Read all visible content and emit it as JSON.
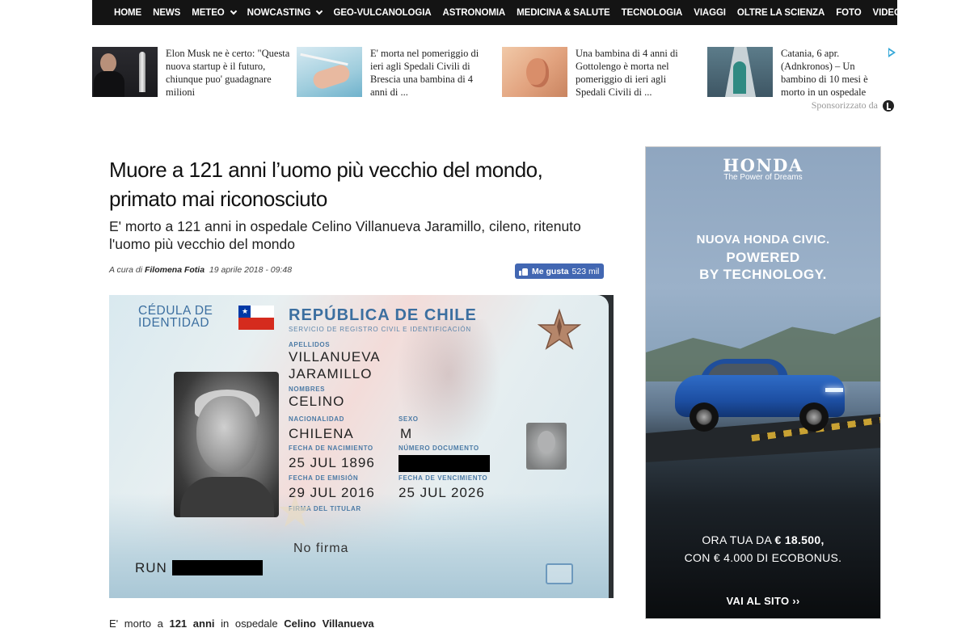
{
  "nav": {
    "items": [
      {
        "label": "HOME"
      },
      {
        "label": "NEWS"
      },
      {
        "label": "METEO"
      },
      {
        "label": "NOWCASTING"
      },
      {
        "label": "GEO-VULCANOLOGIA"
      },
      {
        "label": "ASTRONOMIA"
      },
      {
        "label": "MEDICINA & SALUTE"
      },
      {
        "label": "TECNOLOGIA"
      },
      {
        "label": "VIAGGI"
      },
      {
        "label": "OLTRE LA SCIENZA"
      },
      {
        "label": "FOTO"
      },
      {
        "label": "VIDEO"
      }
    ],
    "search_icon": "search-icon"
  },
  "sponsored": {
    "items": [
      {
        "text": "Elon Musk ne è certo: \"Questa nuova startup è il futuro, chiunque puo' guadagnare milioni"
      },
      {
        "text": "E' morta nel pomeriggio di ieri agli Spedali Civili di Brescia una bambina di 4 anni di ..."
      },
      {
        "text": "Una bambina di 4 anni di Gottolengo è morta nel pomeriggio di ieri agli Spedali Civili di ..."
      },
      {
        "text": "Catania, 6 apr. (Adnkronos) – Un bambino di 10 mesi è morto in un ospedale"
      }
    ],
    "label": "Sponsorizzato da"
  },
  "article": {
    "title_line1": "Muore a 121 anni l’uomo più vecchio del mondo,",
    "title_line2": "primato mai riconosciuto",
    "subtitle": "E' morto a 121 anni in ospedale Celino Villanueva Jaramillo, cileno, ritenuto l'uomo più vecchio del mondo",
    "byline_prefix": "A cura di",
    "author": "Filomena Fotia",
    "date": "19 aprile 2018 - 09:48",
    "like_label": "Me gusta",
    "like_count": "523 mil",
    "body_prefix": "E' morto a",
    "body_age": "121 anni",
    "body_mid": "in ospedale",
    "body_name": "Celino Villanueva"
  },
  "id_card": {
    "cedula_line1": "CÉDULA DE",
    "cedula_line2": "IDENTIDAD",
    "republic": "REPÚBLICA DE CHILE",
    "service": "SERVICIO DE REGISTRO CIVIL E IDENTIFICACIÓN",
    "label_apellidos": "APELLIDOS",
    "apellido1": "VILLANUEVA",
    "apellido2": "JARAMILLO",
    "label_nombres": "NOMBRES",
    "nombres": "CELINO",
    "label_nacionalidad": "NACIONALIDAD",
    "nacionalidad": "CHILENA",
    "label_sexo": "SEXO",
    "sexo": "M",
    "label_nacimiento": "FECHA DE NACIMIENTO",
    "nacimiento": "25 JUL 1896",
    "label_documento": "NÚMERO DOCUMENTO",
    "label_emision": "FECHA DE EMISIÓN",
    "emision": "29 JUL 2016",
    "label_vencimiento": "FECHA DE VENCIMIENTO",
    "vencimiento": "25 JUL 2026",
    "label_firma": "FIRMA DEL TITULAR",
    "firma": "No firma",
    "run": "RUN"
  },
  "ad": {
    "brand": "HONDA",
    "tagline": "The Power of Dreams",
    "headline1": "NUOVA HONDA CIVIC.",
    "headline2": "POWERED",
    "headline3": "BY TECHNOLOGY.",
    "price_prefix": "ORA TUA DA",
    "price": "€ 18.500,",
    "price_line2": "CON € 4.000 DI ECOBONUS.",
    "cta": "VAI AL SITO ››"
  },
  "colors": {
    "nav_bg": "#141414",
    "fb_blue": "#4267b2",
    "card_blue": "#3c6fa0"
  }
}
